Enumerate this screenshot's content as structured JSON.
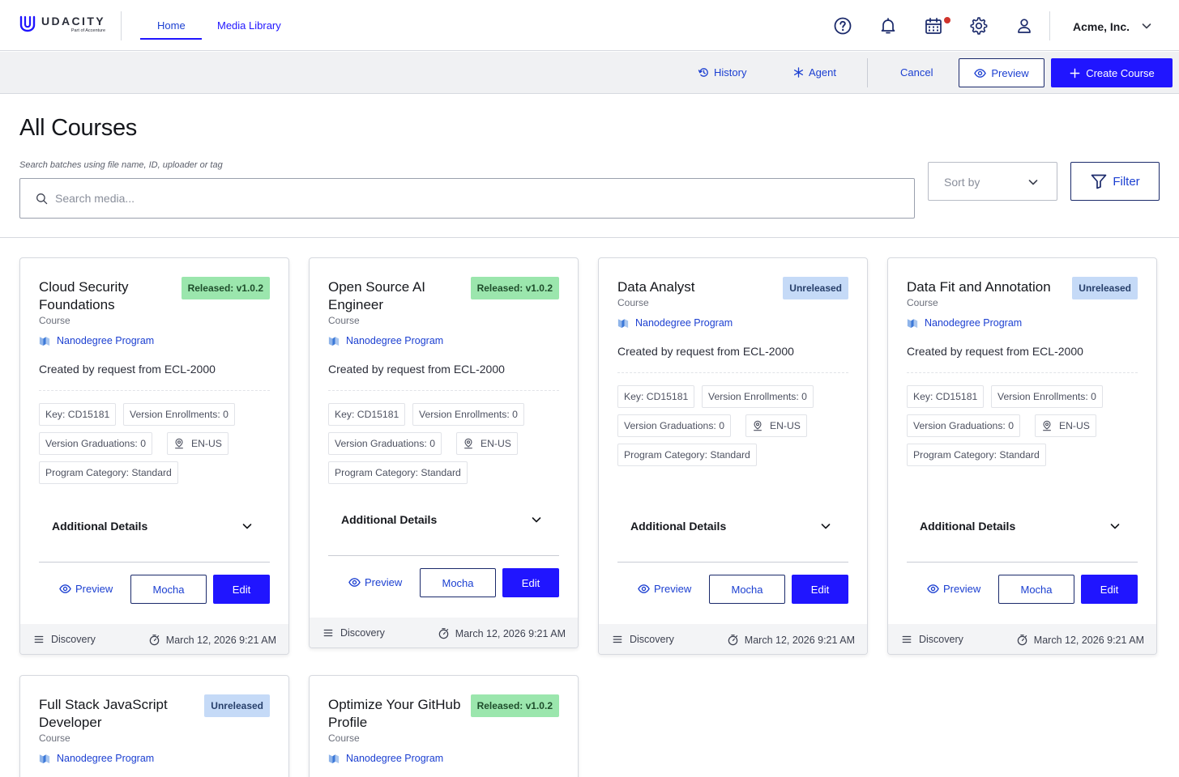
{
  "brand": {
    "name": "UDACITY",
    "tagline": "Part of Accenture"
  },
  "nav": {
    "tabs": [
      {
        "label": "Home",
        "active": true
      },
      {
        "label": "Media Library",
        "active": false
      }
    ]
  },
  "header": {
    "org_name": "Acme, Inc.",
    "icons": [
      "help-icon",
      "bell-icon",
      "calendar-icon",
      "gear-icon",
      "user-icon",
      "chevron-down-icon"
    ]
  },
  "toolbar": {
    "history_label": "History",
    "agent_label": "Agent",
    "cancel_label": "Cancel",
    "preview_label": "Preview",
    "create_label": "Create Course"
  },
  "page": {
    "title": "All Courses"
  },
  "search": {
    "label": "Search batches using file name, ID, uploader or tag",
    "placeholder": "Search media...",
    "value": ""
  },
  "sort": {
    "placeholder": "Sort by"
  },
  "filter": {
    "label": "Filter"
  },
  "colors": {
    "primary": "#2015ff",
    "released_badge": "#9be6ad",
    "unreleased_badge": "#c5daf7",
    "notification_dot": "#d0342c"
  },
  "card_labels": {
    "additional_details": "Additional Details",
    "preview": "Preview",
    "mocha": "Mocha",
    "edit": "Edit"
  },
  "courses": [
    {
      "title": "Cloud Security Foundations",
      "status": "Released: v1.0.2",
      "status_type": "released",
      "type": "Course",
      "program": "Nanodegree Program",
      "description": "Created by request from ECL-2000",
      "key": "Key: CD15181",
      "enrollments": "Version Enrollments: 0",
      "graduations": "Version Graduations: 0",
      "locale": "EN-US",
      "category": "Program Category: Standard",
      "footer_category": "Discovery",
      "timestamp": "March 12, 2026 9:21 AM"
    },
    {
      "title": "Open Source AI Engineer",
      "status": "Released: v1.0.2",
      "status_type": "released",
      "type": "Course",
      "program": "Nanodegree Program",
      "description": "Created by request from ECL-2000",
      "key": "Key: CD15181",
      "enrollments": "Version Enrollments: 0",
      "graduations": "Version Graduations: 0",
      "locale": "EN-US",
      "category": "Program Category: Standard",
      "footer_category": "Discovery",
      "timestamp": "March 12, 2026 9:21 AM"
    },
    {
      "title": "Data Analyst",
      "status": "Unreleased",
      "status_type": "unreleased",
      "type": "Course",
      "program": "Nanodegree Program",
      "description": "Created by request from ECL-2000",
      "key": "Key: CD15181",
      "enrollments": "Version Enrollments: 0",
      "graduations": "Version Graduations: 0",
      "locale": "EN-US",
      "category": "Program Category: Standard",
      "footer_category": "Discovery",
      "timestamp": "March 12, 2026 9:21 AM"
    },
    {
      "title": "Data Fit and Annotation",
      "status": "Unreleased",
      "status_type": "unreleased",
      "type": "Course",
      "program": "Nanodegree Program",
      "description": "Created by request from ECL-2000",
      "key": "Key: CD15181",
      "enrollments": "Version Enrollments: 0",
      "graduations": "Version Graduations: 0",
      "locale": "EN-US",
      "category": "Program Category: Standard",
      "footer_category": "Discovery",
      "timestamp": "March 12, 2026 9:21 AM"
    },
    {
      "title": "Full Stack JavaScript Developer",
      "status": "Unreleased",
      "status_type": "unreleased",
      "type": "Course",
      "program": "Nanodegree Program"
    },
    {
      "title": "Optimize Your GitHub Profile",
      "status": "Released: v1.0.2",
      "status_type": "released",
      "type": "Course",
      "program": "Nanodegree Program"
    }
  ]
}
